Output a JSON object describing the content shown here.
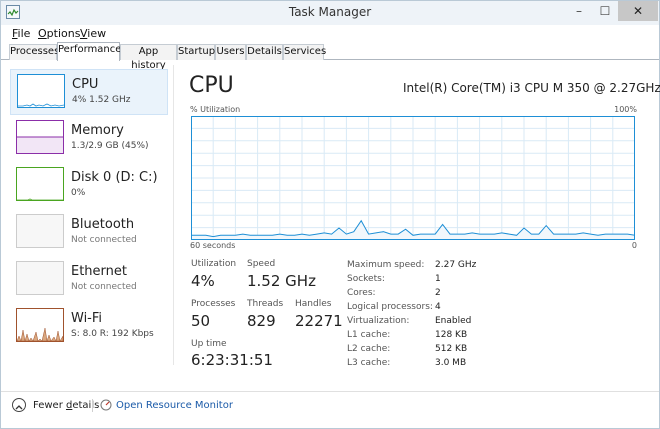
{
  "window": {
    "title": "Task Manager",
    "min_glyph": "–",
    "max_glyph": "☐",
    "close_glyph": "✕"
  },
  "menu": [
    {
      "key": "F",
      "rest": "ile"
    },
    {
      "key": "O",
      "rest": "ptions"
    },
    {
      "key": "V",
      "rest": "iew"
    }
  ],
  "tabs": [
    "Processes",
    "Performance",
    "App history",
    "Startup",
    "Users",
    "Details",
    "Services"
  ],
  "active_tab": "Performance",
  "sidebar": [
    {
      "title": "CPU",
      "sub": "4% 1.52 GHz",
      "color": "#1e8fd6",
      "selected": true
    },
    {
      "title": "Memory",
      "sub": "1.3/2.9 GB (45%)",
      "color": "#8b2ea8"
    },
    {
      "title": "Disk 0 (D: C:)",
      "sub": "0%",
      "color": "#4aa520"
    },
    {
      "title": "Bluetooth",
      "sub": "Not connected",
      "color": "#cccccc"
    },
    {
      "title": "Ethernet",
      "sub": "Not connected",
      "color": "#cccccc"
    },
    {
      "title": "Wi-Fi",
      "sub": "S: 8.0 R: 192 Kbps",
      "color": "#a0522d"
    }
  ],
  "main": {
    "title": "CPU",
    "model": "Intel(R) Core(TM) i3 CPU M 350 @ 2.27GHz",
    "graph": {
      "ylabel": "% Utilization",
      "ymax_label": "100%",
      "xlabel": "60 seconds",
      "xmin_label": "0",
      "line_color": "#1e8fd6",
      "grid_color": "#d9eaf6",
      "points": [
        3,
        3,
        3,
        2,
        3,
        3,
        3,
        4,
        3,
        3,
        3,
        3,
        4,
        3,
        3,
        4,
        3,
        4,
        5,
        4,
        9,
        4,
        6,
        15,
        4,
        5,
        6,
        4,
        4,
        8,
        3,
        4,
        4,
        4,
        12,
        4,
        4,
        4,
        5,
        4,
        4,
        4,
        5,
        4,
        3,
        9,
        4,
        4,
        11,
        4,
        4,
        4,
        4,
        5,
        4,
        3,
        4,
        4,
        4,
        4,
        3
      ]
    },
    "stats": {
      "utilization_label": "Utilization",
      "utilization": "4%",
      "speed_label": "Speed",
      "speed": "1.52 GHz",
      "processes_label": "Processes",
      "processes": "50",
      "threads_label": "Threads",
      "threads": "829",
      "handles_label": "Handles",
      "handles": "22271",
      "uptime_label": "Up time",
      "uptime": "6:23:31:51"
    },
    "info": [
      {
        "label": "Maximum speed:",
        "value": "2.27 GHz"
      },
      {
        "label": "Sockets:",
        "value": "1"
      },
      {
        "label": "Cores:",
        "value": "2"
      },
      {
        "label": "Logical processors:",
        "value": "4"
      },
      {
        "label": "Virtualization:",
        "value": "Enabled"
      },
      {
        "label": "L1 cache:",
        "value": "128 KB"
      },
      {
        "label": "L2 cache:",
        "value": "512 KB"
      },
      {
        "label": "L3 cache:",
        "value": "3.0 MB"
      }
    ]
  },
  "footer": {
    "fewer_details": "Fewer details",
    "fewer_underline": "d",
    "resource_monitor": "Open Resource Monitor"
  }
}
